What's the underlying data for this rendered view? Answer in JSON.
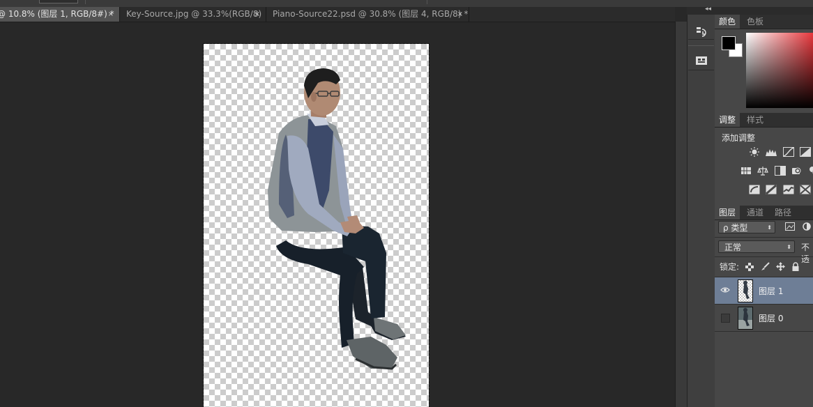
{
  "window": {
    "tabs": [
      {
        "label": "@ 10.8% (图层 1, RGB/8#) *",
        "active": true
      },
      {
        "label": "Key-Source.jpg @ 33.3%(RGB/8)",
        "active": false
      },
      {
        "label": "Piano-Source22.psd @ 30.8% (图层 4, RGB/8) *",
        "active": false
      }
    ],
    "close_glyph": "×"
  },
  "side_strip": {
    "collapse_glyph": "◂◂",
    "buttons": [
      "history-icon",
      "properties-icon"
    ]
  },
  "color_panel": {
    "tabs": [
      "颜色",
      "色板"
    ],
    "foreground": "#000000",
    "background": "#ffffff",
    "spectrum_hue": "#e8383d"
  },
  "adjustments_panel": {
    "tabs": [
      "调整",
      "样式"
    ],
    "title": "添加调整",
    "icons": [
      [
        "brightness-contrast-icon",
        "levels-icon",
        "curves-icon",
        "exposure-icon"
      ],
      [
        "vibrance-icon",
        "color-balance-icon",
        "black-white-icon",
        "photo-filter-icon",
        "channel-mixer-icon"
      ],
      [
        "invert-icon",
        "posterize-icon",
        "threshold-icon",
        "gradient-map-icon"
      ]
    ]
  },
  "layers_panel": {
    "tabs": [
      "图层",
      "通道",
      "路径"
    ],
    "filter_kind": "ρ 类型",
    "blend_mode": "正常",
    "opacity_label": "不透",
    "lock_label": "锁定:",
    "layers": [
      {
        "name": "图层 1",
        "visible": true,
        "selected": true
      },
      {
        "name": "图层 0",
        "visible": false,
        "selected": false
      }
    ]
  }
}
